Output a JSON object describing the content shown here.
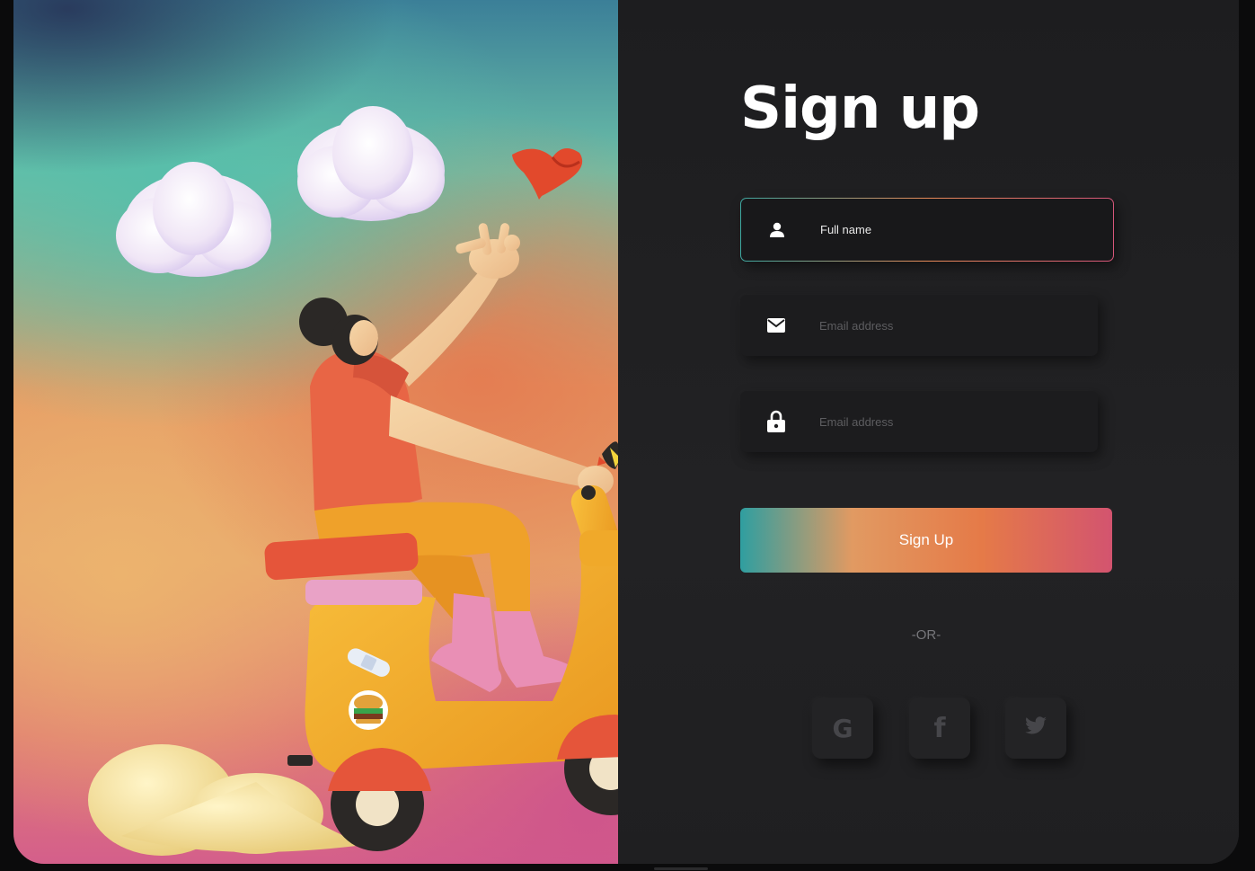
{
  "form": {
    "title": "Sign up",
    "fields": [
      {
        "icon": "user-icon",
        "placeholder": "Full name",
        "value": ""
      },
      {
        "icon": "envelope-icon",
        "placeholder": "Email address",
        "value": ""
      },
      {
        "icon": "lock-icon",
        "placeholder": "Email address",
        "value": ""
      }
    ],
    "submit_label": "Sign Up",
    "divider_text": "-OR-",
    "social": [
      {
        "icon": "google-icon",
        "glyph": "G"
      },
      {
        "icon": "facebook-icon",
        "glyph": "f"
      },
      {
        "icon": "twitter-icon",
        "glyph": ""
      }
    ]
  },
  "colors": {
    "panel_bg": "#1f1f21",
    "button_gradient": [
      "#2f9ea0",
      "#e19a62",
      "#e57a48",
      "#d3546f"
    ],
    "text_primary": "#ffffff",
    "text_muted": "#77777b"
  }
}
